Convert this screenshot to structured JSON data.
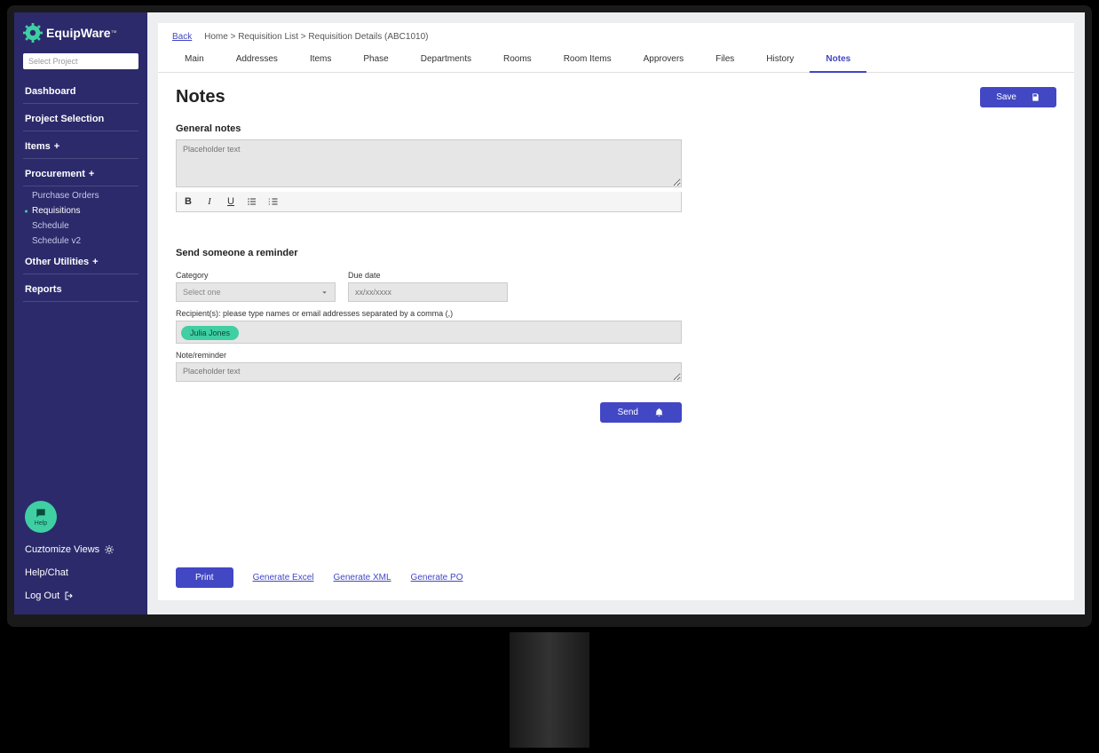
{
  "brand": {
    "name": "EquipWare",
    "tm": "™"
  },
  "sidebar": {
    "project_select_placeholder": "Select Project",
    "items": [
      {
        "label": "Dashboard"
      },
      {
        "label": "Project Selection"
      },
      {
        "label": "Items",
        "expandable": true
      },
      {
        "label": "Procurement",
        "expandable": true,
        "children": [
          {
            "label": "Purchase Orders"
          },
          {
            "label": "Requisitions",
            "active": true
          },
          {
            "label": "Schedule"
          },
          {
            "label": "Schedule v2"
          }
        ]
      },
      {
        "label": "Other Utilities",
        "expandable": true
      },
      {
        "label": "Reports"
      }
    ],
    "help_fab": "Help",
    "customize": "Cuztomize Views",
    "help_chat": "Help/Chat",
    "logout": "Log Out"
  },
  "breadcrumb": {
    "back": "Back",
    "path": "Home > Requisition List > Requisition Details (ABC1010)"
  },
  "tabs": [
    "Main",
    "Addresses",
    "Items",
    "Phase",
    "Departments",
    "Rooms",
    "Room Items",
    "Approvers",
    "Files",
    "History",
    "Notes"
  ],
  "active_tab": "Notes",
  "page": {
    "title": "Notes",
    "save": "Save",
    "general_notes_label": "General notes",
    "general_notes_placeholder": "Placeholder text",
    "reminder_heading": "Send someone a reminder",
    "category_label": "Category",
    "category_placeholder": "Select one",
    "due_date_label": "Due date",
    "due_date_placeholder": "xx/xx/xxxx",
    "recipients_label": "Recipient(s): please type names or email addresses separated by a comma (,)",
    "recipient_chip": "Julia Jones",
    "note_label": "Note/reminder",
    "note_placeholder": "Placeholder text",
    "send": "Send"
  },
  "footer": {
    "print": "Print",
    "gen_excel": "Generate Excel",
    "gen_xml": "Generate XML",
    "gen_po": "Generate PO"
  }
}
